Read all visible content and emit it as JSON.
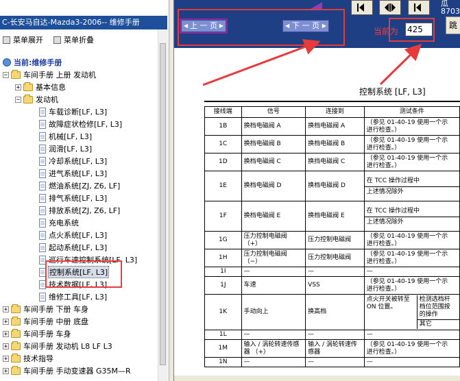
{
  "left_panel": {
    "title": "C-长安马自达-Mazda3-2006-- 维修手册",
    "expand_all": "菜单展开",
    "collapse_all": "菜单折叠",
    "tree": [
      {
        "level": 0,
        "kind": "book",
        "label": "当前:维修手册",
        "current": true
      },
      {
        "level": 0,
        "kind": "folder",
        "exp": "−",
        "label": "车间手册 上册 发动机"
      },
      {
        "level": 1,
        "kind": "folder",
        "exp": "+",
        "label": "基本信息"
      },
      {
        "level": 1,
        "kind": "folder",
        "exp": "−",
        "label": "发动机"
      },
      {
        "level": 2,
        "kind": "doc",
        "label": "车载诊断[LF, L3]"
      },
      {
        "level": 2,
        "kind": "doc",
        "label": "故障症状检修[LF, L3]"
      },
      {
        "level": 2,
        "kind": "doc",
        "label": "机械[LF, L3]"
      },
      {
        "level": 2,
        "kind": "doc",
        "label": "润滑[LF, L3]"
      },
      {
        "level": 2,
        "kind": "doc",
        "label": "冷却系统[LF, L3]"
      },
      {
        "level": 2,
        "kind": "doc",
        "label": "进气系统[LF, L3]"
      },
      {
        "level": 2,
        "kind": "doc",
        "label": "燃油系统[ZJ, Z6, LF]"
      },
      {
        "level": 2,
        "kind": "doc",
        "label": "排气系统[LF, L3]"
      },
      {
        "level": 2,
        "kind": "doc",
        "label": "排放系统[ZJ, Z6, LF]"
      },
      {
        "level": 2,
        "kind": "doc",
        "label": "充电系统"
      },
      {
        "level": 2,
        "kind": "doc",
        "label": "点火系统[LF, L3]"
      },
      {
        "level": 2,
        "kind": "doc",
        "label": "起动系统[LF, L3]"
      },
      {
        "level": 2,
        "kind": "doc",
        "label": "巡行车速控制系统[LF, L3]"
      },
      {
        "level": 2,
        "kind": "doc",
        "label": "控制系统[LF, L3]",
        "selected": true
      },
      {
        "level": 2,
        "kind": "doc",
        "label": "技术数据[LF, L3]"
      },
      {
        "level": 2,
        "kind": "doc",
        "label": "维修工具[LF, L3]"
      },
      {
        "level": 0,
        "kind": "folder",
        "exp": "+",
        "label": "车间手册 下册 车身"
      },
      {
        "level": 0,
        "kind": "folder",
        "exp": "+",
        "label": "车间手册 中册 底盘"
      },
      {
        "level": 0,
        "kind": "folder",
        "exp": "+",
        "label": "车间手册 车身"
      },
      {
        "level": 0,
        "kind": "folder",
        "exp": "+",
        "label": "车间手册 发动机 L8 LF L3"
      },
      {
        "level": 0,
        "kind": "folder",
        "exp": "+",
        "label": "技术指导"
      },
      {
        "level": 0,
        "kind": "folder",
        "exp": "+",
        "label": "车间手册 手动变速器 G35M—R"
      }
    ]
  },
  "toolbar": {
    "prev_label": "上 一 页",
    "next_label": "下 一 页",
    "current_label": "当前为",
    "page_value": "425",
    "jump_label": "跳",
    "phone_partial_1": "瓜",
    "phone_partial_2": "8703"
  },
  "document": {
    "title": "控制系统 [LF, L3]",
    "headers": [
      "接线端",
      "信号",
      "连接到",
      "测试条件"
    ],
    "rows": [
      {
        "terminal": "1B",
        "signal": "换档电磁阀 A",
        "to": "换档电磁阀 A",
        "cond": [
          "（参见 01-40-19 使用一个示",
          "进行检查。）"
        ]
      },
      {
        "terminal": "1C",
        "signal": "换档电磁阀 B",
        "to": "换档电磁阀 B",
        "cond": [
          "（参见 01-40-19 使用一个示",
          "进行检查。）"
        ]
      },
      {
        "terminal": "1D",
        "signal": "换档电磁阀 C",
        "to": "换挡电磁阀 C",
        "cond": [
          "（参见 01-40-19 使用一个示",
          "进行检查。）"
        ]
      },
      {
        "terminal": "1E",
        "signal": "换档电磁阀 D",
        "to": "换档电磁阀 D",
        "cond": [
          "在 TCC 操作过程中"
        ],
        "cond2": [
          "上述情况除外"
        ]
      },
      {
        "terminal": "1F",
        "signal": "换档电磁阀 E",
        "to": "换档电磁阀 E",
        "cond": [
          "在 TCC 操作过程中"
        ],
        "cond2": [
          "上述情况除外"
        ]
      },
      {
        "terminal": "1G",
        "signal": "压力控制电磁阀 （+）",
        "to": "压力控制电磁阀",
        "cond": [
          "（参见 01-40-19 使用一个示",
          "进行检查。）"
        ]
      },
      {
        "terminal": "1H",
        "signal": "压力控制电磁阀 （−）",
        "to": "压力控制电磁阀",
        "cond": [
          "（参见 01-40-19 使用一个示",
          "进行检查。）"
        ]
      },
      {
        "terminal": "1I",
        "signal": "—",
        "to": "—",
        "cond": [
          "—"
        ]
      },
      {
        "terminal": "1J",
        "signal": "车速",
        "to": "VSS",
        "cond": [
          "（参见 01-40-19 使用一个示",
          "进行检查。）"
        ]
      },
      {
        "terminal": "1K",
        "signal": "手动向上",
        "to": "换高档",
        "cond": [
          "点火开关被转至",
          "ON 位置。"
        ],
        "extra": [
          "检测选档杆",
          "档位范围按",
          "的操作"
        ],
        "extra2": [
          "其它"
        ]
      },
      {
        "terminal": "1L",
        "signal": "—",
        "to": "—",
        "cond": [
          "—"
        ]
      },
      {
        "terminal": "1M",
        "signal": "输入 / 涡轮转速传感器 （+）",
        "to": "输入 / 涡轮转速传感器",
        "cond": [
          "（参见 01-40-19 使用一个示",
          "进行检查。）"
        ]
      },
      {
        "terminal": "1N",
        "signal": "—",
        "to": "—",
        "cond": [
          "—"
        ]
      }
    ]
  },
  "colors": {
    "titlebar": "#1d4f9a",
    "topbar": "#1e3f84",
    "annotation": "#e53b3b",
    "button": "#7d8ed1"
  }
}
